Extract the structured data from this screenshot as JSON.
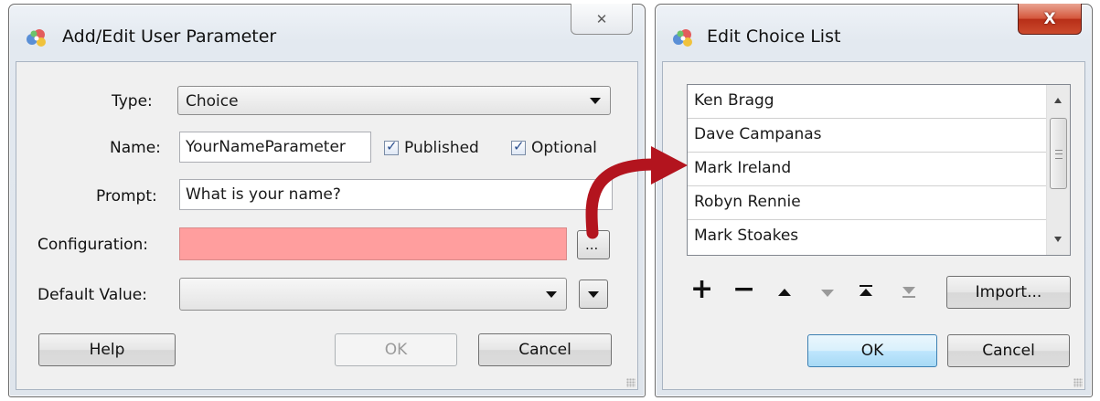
{
  "colors": {
    "config_error_fill": "#ff9e9e",
    "arrow_red": "#b3141e"
  },
  "dialog_params": {
    "title": "Add/Edit User Parameter",
    "close_glyph": "✕",
    "type": {
      "label": "Type:",
      "value": "Choice"
    },
    "name": {
      "label": "Name:",
      "value": "YourNameParameter",
      "published_label": "Published",
      "optional_label": "Optional"
    },
    "prompt": {
      "label": "Prompt:",
      "value": "What is your name?"
    },
    "configuration": {
      "label": "Configuration:",
      "value": "",
      "browse_label": "..."
    },
    "default_value": {
      "label": "Default Value:",
      "value": ""
    },
    "buttons": {
      "help": "Help",
      "ok": "OK",
      "cancel": "Cancel"
    }
  },
  "dialog_choices": {
    "title": "Edit Choice List",
    "close_glyph": "X",
    "items": [
      "Ken Bragg",
      "Dave Campanas",
      "Mark Ireland",
      "Robyn Rennie",
      "Mark Stoakes"
    ],
    "toolbar": {
      "add": "+",
      "remove": "−",
      "import": "Import..."
    },
    "buttons": {
      "ok": "OK",
      "cancel": "Cancel"
    }
  }
}
